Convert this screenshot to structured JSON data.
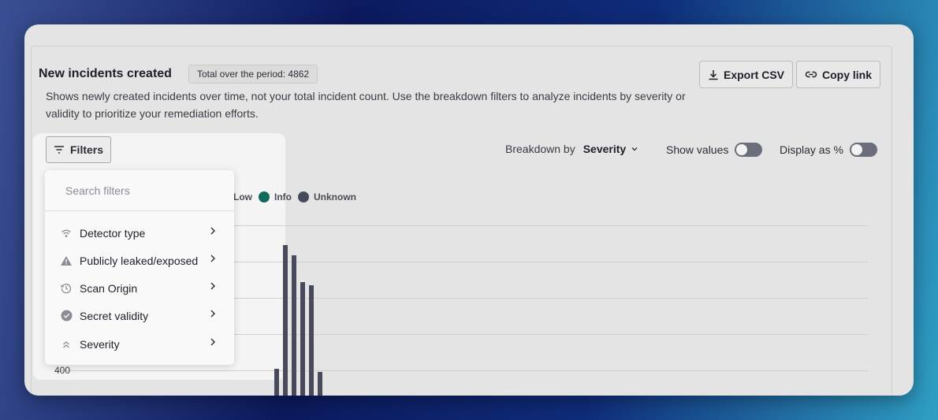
{
  "header": {
    "title": "New incidents created",
    "total_badge": "Total over the period: 4862",
    "description": "Shows newly created incidents over time, not your total incident count. Use the breakdown filters to analyze incidents by severity or validity to prioritize your remediation efforts.",
    "export_label": "Export CSV",
    "copy_label": "Copy link"
  },
  "controls": {
    "filters_label": "Filters",
    "breakdown_prefix": "Breakdown by",
    "breakdown_value": "Severity",
    "show_values_label": "Show values",
    "display_percent_label": "Display as %"
  },
  "legend": [
    {
      "label": "Low",
      "color": "#5b5e6a"
    },
    {
      "label": "Info",
      "color": "#0f6a5a"
    },
    {
      "label": "Unknown",
      "color": "#474a5b"
    }
  ],
  "chart": {
    "visible_tick": "400"
  },
  "filter_menu": {
    "search_placeholder": "Search filters",
    "items": [
      {
        "label": "Detector type",
        "icon": "wifi-icon"
      },
      {
        "label": "Publicly leaked/exposed",
        "icon": "warning-icon"
      },
      {
        "label": "Scan Origin",
        "icon": "history-icon"
      },
      {
        "label": "Secret validity",
        "icon": "check-circle-icon"
      },
      {
        "label": "Severity",
        "icon": "double-chevron-up-icon"
      }
    ]
  },
  "colors": {
    "bar": "#474a5b",
    "info": "#0f6a5a"
  }
}
